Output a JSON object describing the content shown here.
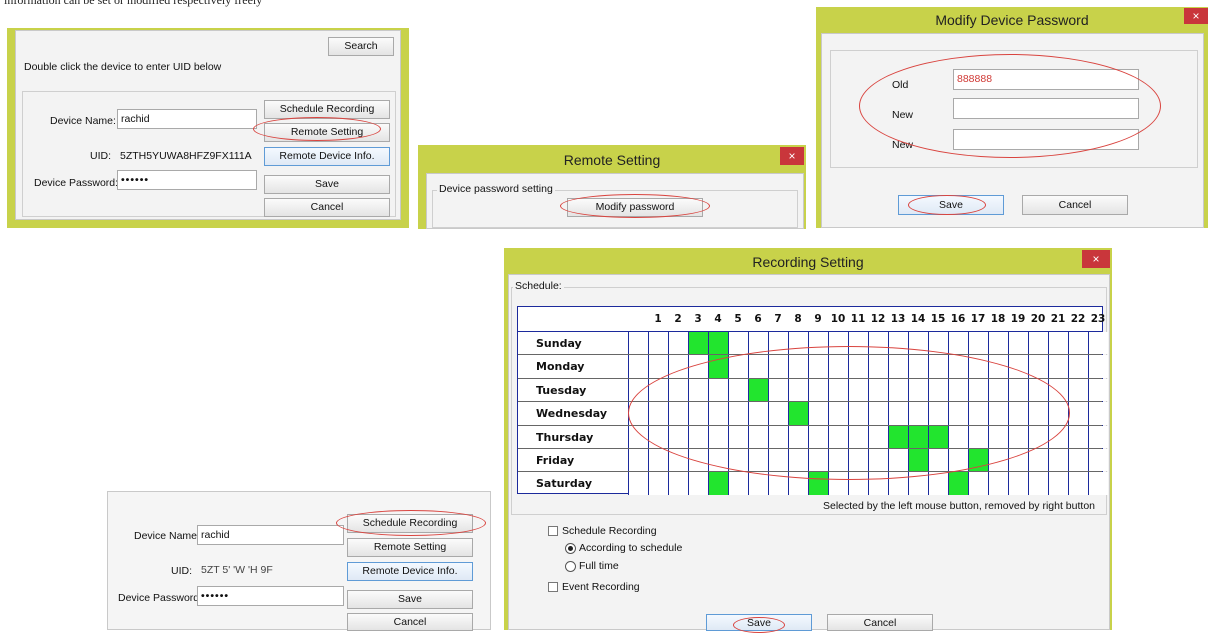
{
  "caption": "information can be set or modified respectively freely",
  "device_dialog_top": {
    "search_label": "Search",
    "hint": "Double click the device to enter UID below",
    "device_name_label": "Device Name:",
    "device_name_value": "rachid",
    "uid_label": "UID:",
    "uid_value": "5ZTH5YUWA8HFZ9FX111A",
    "password_label": "Device Password:",
    "password_value": "••••••",
    "schedule_recording_label": "Schedule Recording",
    "remote_setting_label": "Remote Setting",
    "remote_device_info_label": "Remote Device Info.",
    "save_label": "Save",
    "cancel_label": "Cancel"
  },
  "remote_setting_dialog": {
    "title": "Remote Setting",
    "close_label": "×",
    "group_label": "Device password setting",
    "modify_password_label": "Modify password"
  },
  "modify_password_dialog": {
    "title": "Modify Device Password",
    "close_label": "×",
    "old_label": "Old",
    "old_value": "888888",
    "new_label": "New",
    "new_confirm_label": "New",
    "save_label": "Save",
    "cancel_label": "Cancel"
  },
  "device_dialog_bottom": {
    "device_name_label": "Device Name:",
    "device_name_value": "rachid",
    "uid_label": "UID:",
    "uid_value": "5ZT  5'  'W  'H  9F",
    "password_label": "Device Password:",
    "password_value": "••••••",
    "schedule_recording_label": "Schedule Recording",
    "remote_setting_label": "Remote Setting",
    "remote_device_info_label": "Remote Device Info.",
    "save_label": "Save",
    "cancel_label": "Cancel"
  },
  "recording_dialog": {
    "title": "Recording Setting",
    "close_label": "×",
    "schedule_group_label": "Schedule:",
    "hours": [
      "1",
      "2",
      "3",
      "4",
      "5",
      "6",
      "7",
      "8",
      "9",
      "10",
      "11",
      "12",
      "13",
      "14",
      "15",
      "16",
      "17",
      "18",
      "19",
      "20",
      "21",
      "22",
      "23"
    ],
    "days": [
      "Sunday",
      "Monday",
      "Tuesday",
      "Wednesday",
      "Thursday",
      "Friday",
      "Saturday"
    ],
    "selected_slots": [
      [
        3,
        4
      ],
      [
        4
      ],
      [
        6
      ],
      [
        8
      ],
      [
        13,
        14,
        15
      ],
      [
        14,
        17
      ],
      [
        4,
        9,
        16
      ]
    ],
    "selected_color": "#22e52e",
    "grid_line_color": "#1c2a9c",
    "hint": "Selected by the left mouse button, removed by right button",
    "schedule_recording_checkbox_label": "Schedule Recording",
    "according_to_schedule_label": "According to schedule",
    "full_time_label": "Full time",
    "event_recording_label": "Event Recording",
    "save_label": "Save",
    "cancel_label": "Cancel"
  },
  "accent_colors": {
    "panel_border": "#c8d24a",
    "highlight_ring": "#d9443f",
    "close_button": "#c9363b"
  }
}
